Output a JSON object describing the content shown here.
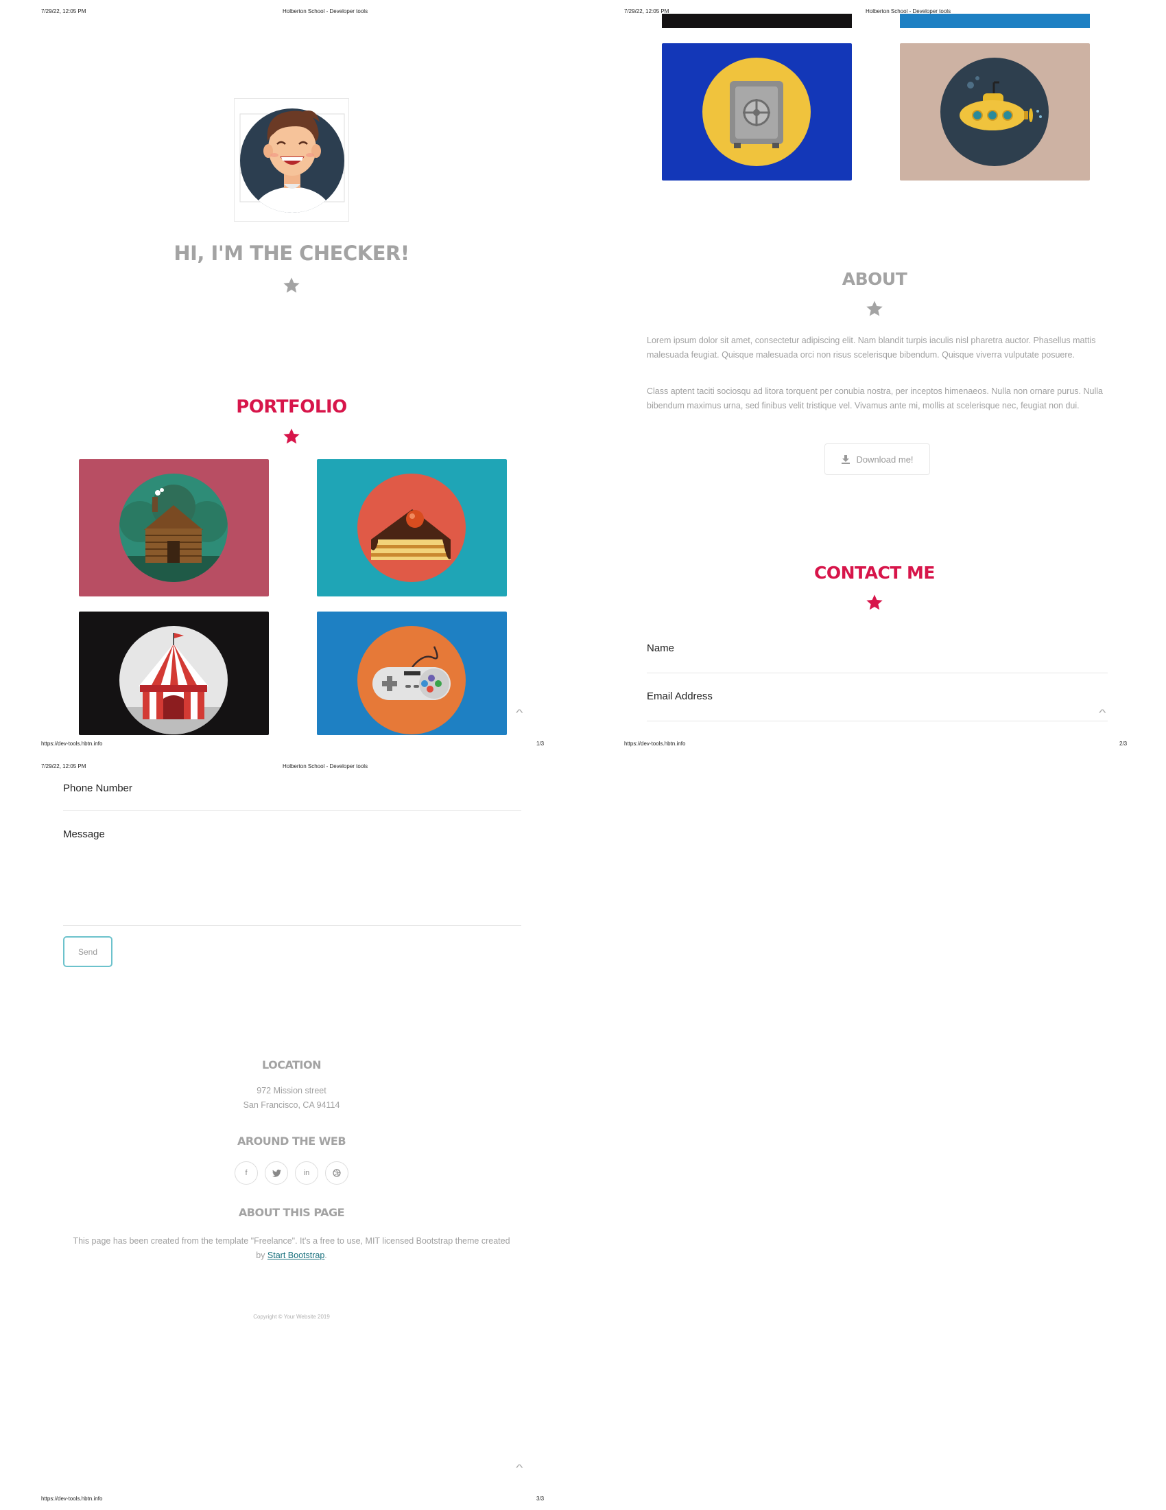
{
  "print": {
    "datetime": "7/29/22, 12:05 PM",
    "doc_title": "Holberton School - Developer tools",
    "url": "https://dev-tools.hbtn.info",
    "page1_num": "1/3",
    "page2_num": "2/3",
    "page3_num": "3/3"
  },
  "hero": {
    "title": "HI, I'M THE CHECKER!"
  },
  "portfolio": {
    "title": "PORTFOLIO",
    "items": [
      {
        "subject": "log-cabin",
        "bg": "#b84e63",
        "circle": "#2e8c77"
      },
      {
        "subject": "cake-slice",
        "bg": "#1fa5b6",
        "circle": "#e05a47"
      },
      {
        "subject": "circus-tent",
        "bg": "#141213",
        "circle": "#e6e6e6"
      },
      {
        "subject": "game-controller",
        "bg": "#1e80c3",
        "circle": "#e67938"
      },
      {
        "subject": "safe",
        "bg": "#1337b8",
        "circle": "#f0c33d"
      },
      {
        "subject": "submarine",
        "bg": "#cdb2a3",
        "circle": "#2e3f4e"
      }
    ]
  },
  "about": {
    "title": "ABOUT",
    "p1": "Lorem ipsum dolor sit amet, consectetur adipiscing elit. Nam blandit turpis iaculis nisl pharetra auctor. Phasellus mattis malesuada feugiat. Quisque malesuada orci non risus scelerisque bibendum. Quisque viverra vulputate posuere.",
    "p2": "Class aptent taciti sociosqu ad litora torquent per conubia nostra, per inceptos himenaeos. Nulla non ornare purus. Nulla bibendum maximus urna, sed finibus velit tristique vel. Vivamus ante mi, mollis at scelerisque nec, feugiat non dui.",
    "download_label": "Download me!"
  },
  "contact": {
    "title": "CONTACT ME",
    "name_label": "Name",
    "email_label": "Email Address",
    "phone_label": "Phone Number",
    "message_label": "Message",
    "send_label": "Send"
  },
  "footer": {
    "location_title": "LOCATION",
    "address1": "972 Mission street",
    "address2": "San Francisco, CA 94114",
    "web_title": "AROUND THE WEB",
    "social": [
      "f",
      "t",
      "in",
      "d"
    ],
    "about_title": "ABOUT THIS PAGE",
    "about_text": "This page has been created from the template \"Freelance\". It's a free to use, MIT licensed Bootstrap theme created by",
    "about_link": "Start Bootstrap",
    "about_end": ".",
    "copyright": "Copyright © Your Website 2019"
  },
  "colors": {
    "accent": "#d7154a",
    "muted": "#a0a0a0",
    "teal": "#6cc2cc"
  }
}
